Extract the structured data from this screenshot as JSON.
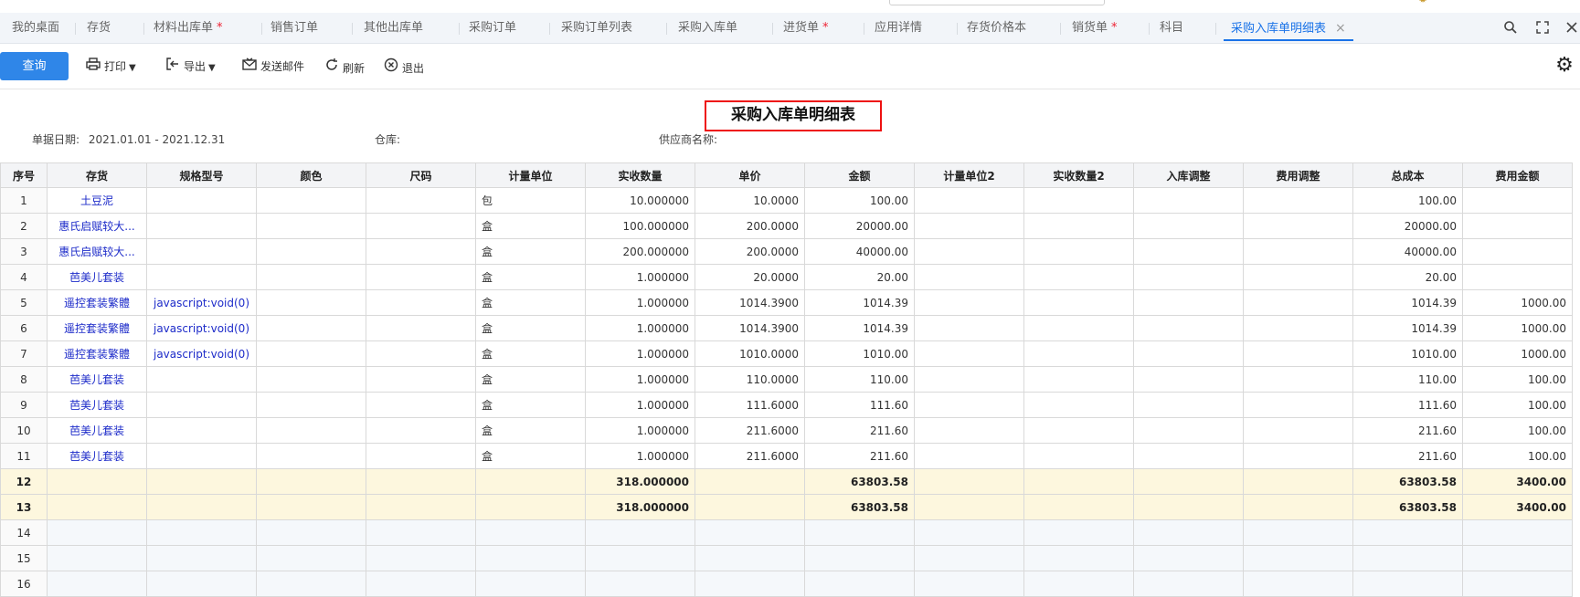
{
  "tabs": [
    {
      "label": "我的桌面",
      "modified": false
    },
    {
      "label": "存货",
      "modified": false
    },
    {
      "label": "材料出库单",
      "modified": true
    },
    {
      "label": "销售订单",
      "modified": false
    },
    {
      "label": "其他出库单",
      "modified": false
    },
    {
      "label": "采购订单",
      "modified": false
    },
    {
      "label": "采购订单列表",
      "modified": false
    },
    {
      "label": "采购入库单",
      "modified": false
    },
    {
      "label": "进货单",
      "modified": true
    },
    {
      "label": "应用详情",
      "modified": false
    },
    {
      "label": "存货价格本",
      "modified": false
    },
    {
      "label": "销货单",
      "modified": true
    },
    {
      "label": "科目",
      "modified": false
    },
    {
      "label": "采购入库单明细表",
      "modified": false,
      "active": true
    }
  ],
  "tab_modified_mark": "*",
  "tab_close_glyph": "×",
  "accent_color": "#1a73e8",
  "toolbar": {
    "query_label": "查询",
    "print_label": "打印",
    "export_label": "导出",
    "send_mail_label": "发送邮件",
    "refresh_label": "刷新",
    "exit_label": "退出"
  },
  "report": {
    "title": "采购入库单明细表",
    "date_label": "单据日期:",
    "date_value": "2021.01.01 - 2021.12.31",
    "warehouse_label": "仓库:",
    "supplier_label": "供应商名称:"
  },
  "table": {
    "columns": [
      "序号",
      "存货",
      "规格型号",
      "颜色",
      "尺码",
      "计量单位",
      "实收数量",
      "单价",
      "金额",
      "计量单位2",
      "实收数量2",
      "入库调整",
      "费用调整",
      "总成本",
      "费用金额"
    ],
    "rows": [
      {
        "no": "1",
        "item": "土豆泥",
        "spec": "",
        "color": "",
        "size": "",
        "unit": "包",
        "qty": "10.000000",
        "price": "10.0000",
        "amount": "100.00",
        "unit2": "",
        "qty2": "",
        "adj_in": "",
        "adj_fee": "",
        "total_cost": "100.00",
        "fee": ""
      },
      {
        "no": "2",
        "item": "惠氏启赋较大...",
        "spec": "",
        "color": "",
        "size": "",
        "unit": "盒",
        "qty": "100.000000",
        "price": "200.0000",
        "amount": "20000.00",
        "unit2": "",
        "qty2": "",
        "adj_in": "",
        "adj_fee": "",
        "total_cost": "20000.00",
        "fee": ""
      },
      {
        "no": "3",
        "item": "惠氏启赋较大...",
        "spec": "",
        "color": "",
        "size": "",
        "unit": "盒",
        "qty": "200.000000",
        "price": "200.0000",
        "amount": "40000.00",
        "unit2": "",
        "qty2": "",
        "adj_in": "",
        "adj_fee": "",
        "total_cost": "40000.00",
        "fee": ""
      },
      {
        "no": "4",
        "item": "芭美儿套装",
        "spec": "",
        "color": "",
        "size": "",
        "unit": "盒",
        "qty": "1.000000",
        "price": "20.0000",
        "amount": "20.00",
        "unit2": "",
        "qty2": "",
        "adj_in": "",
        "adj_fee": "",
        "total_cost": "20.00",
        "fee": ""
      },
      {
        "no": "5",
        "item": "遥控套装繁體",
        "spec": "javascript:void(0)",
        "color": "",
        "size": "",
        "unit": "盒",
        "qty": "1.000000",
        "price": "1014.3900",
        "amount": "1014.39",
        "unit2": "",
        "qty2": "",
        "adj_in": "",
        "adj_fee": "",
        "total_cost": "1014.39",
        "fee": "1000.00"
      },
      {
        "no": "6",
        "item": "遥控套装繁體",
        "spec": "javascript:void(0)",
        "color": "",
        "size": "",
        "unit": "盒",
        "qty": "1.000000",
        "price": "1014.3900",
        "amount": "1014.39",
        "unit2": "",
        "qty2": "",
        "adj_in": "",
        "adj_fee": "",
        "total_cost": "1014.39",
        "fee": "1000.00"
      },
      {
        "no": "7",
        "item": "遥控套装繁體",
        "spec": "javascript:void(0)",
        "color": "",
        "size": "",
        "unit": "盒",
        "qty": "1.000000",
        "price": "1010.0000",
        "amount": "1010.00",
        "unit2": "",
        "qty2": "",
        "adj_in": "",
        "adj_fee": "",
        "total_cost": "1010.00",
        "fee": "1000.00"
      },
      {
        "no": "8",
        "item": "芭美儿套装",
        "spec": "",
        "color": "",
        "size": "",
        "unit": "盒",
        "qty": "1.000000",
        "price": "110.0000",
        "amount": "110.00",
        "unit2": "",
        "qty2": "",
        "adj_in": "",
        "adj_fee": "",
        "total_cost": "110.00",
        "fee": "100.00"
      },
      {
        "no": "9",
        "item": "芭美儿套装",
        "spec": "",
        "color": "",
        "size": "",
        "unit": "盒",
        "qty": "1.000000",
        "price": "111.6000",
        "amount": "111.60",
        "unit2": "",
        "qty2": "",
        "adj_in": "",
        "adj_fee": "",
        "total_cost": "111.60",
        "fee": "100.00"
      },
      {
        "no": "10",
        "item": "芭美儿套装",
        "spec": "",
        "color": "",
        "size": "",
        "unit": "盒",
        "qty": "1.000000",
        "price": "211.6000",
        "amount": "211.60",
        "unit2": "",
        "qty2": "",
        "adj_in": "",
        "adj_fee": "",
        "total_cost": "211.60",
        "fee": "100.00"
      },
      {
        "no": "11",
        "item": "芭美儿套装",
        "spec": "",
        "color": "",
        "size": "",
        "unit": "盒",
        "qty": "1.000000",
        "price": "211.6000",
        "amount": "211.60",
        "unit2": "",
        "qty2": "",
        "adj_in": "",
        "adj_fee": "",
        "total_cost": "211.60",
        "fee": "100.00"
      }
    ],
    "totals": [
      {
        "no": "12",
        "qty": "318.000000",
        "amount": "63803.58",
        "total_cost": "63803.58",
        "fee": "3400.00"
      },
      {
        "no": "13",
        "qty": "318.000000",
        "amount": "63803.58",
        "total_cost": "63803.58",
        "fee": "3400.00"
      }
    ],
    "empty_rows": [
      "14",
      "15",
      "16"
    ]
  }
}
